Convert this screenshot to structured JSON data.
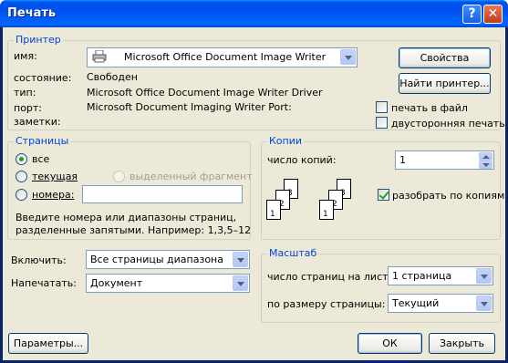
{
  "window": {
    "title": "Печать",
    "help_label": "?",
    "close_label": "✕"
  },
  "printer": {
    "legend": "Принтер",
    "name_label": "имя:",
    "name_value": "Microsoft Office Document Image Writer",
    "status_label": "состояние:",
    "status_value": "Свободен",
    "type_label": "тип:",
    "type_value": "Microsoft Office Document Image Writer Driver",
    "port_label": "порт:",
    "port_value": "Microsoft Document Imaging Writer Port:",
    "notes_label": "заметки:",
    "properties_button": "Свойства",
    "find_button": "Найти принтер...",
    "print_to_file": "печать в файл",
    "duplex": "двусторонняя печать"
  },
  "pages": {
    "legend": "Страницы",
    "all": "все",
    "current": "текущая",
    "selection": "выделенный фрагмент",
    "numbers": "номера:",
    "hint_line1": "Введите номера или диапазоны страниц,",
    "hint_line2": "разделенные запятыми. Например: 1,3,5–12"
  },
  "copies": {
    "legend": "Копии",
    "count_label": "число копий:",
    "count_value": "1",
    "collate": "разобрать по копиям",
    "stack_pages": [
      "1",
      "2",
      "3"
    ]
  },
  "include": {
    "label": "Включить:",
    "value": "Все страницы диапазона"
  },
  "print_what": {
    "label": "Напечатать:",
    "value": "Документ"
  },
  "zoom": {
    "legend": "Масштаб",
    "pages_per_sheet_label": "число страниц на листе:",
    "pages_per_sheet_value": "1 страница",
    "scale_label": "по размеру страницы:",
    "scale_value": "Текущий"
  },
  "footer": {
    "options_button": "Параметры...",
    "ok_button": "ОК",
    "close_button": "Закрыть"
  },
  "colors": {
    "title_bar": "#0055ea",
    "dialog_bg": "#ece9d8",
    "group_legend": "#0046d5",
    "check_green": "#21a121"
  }
}
